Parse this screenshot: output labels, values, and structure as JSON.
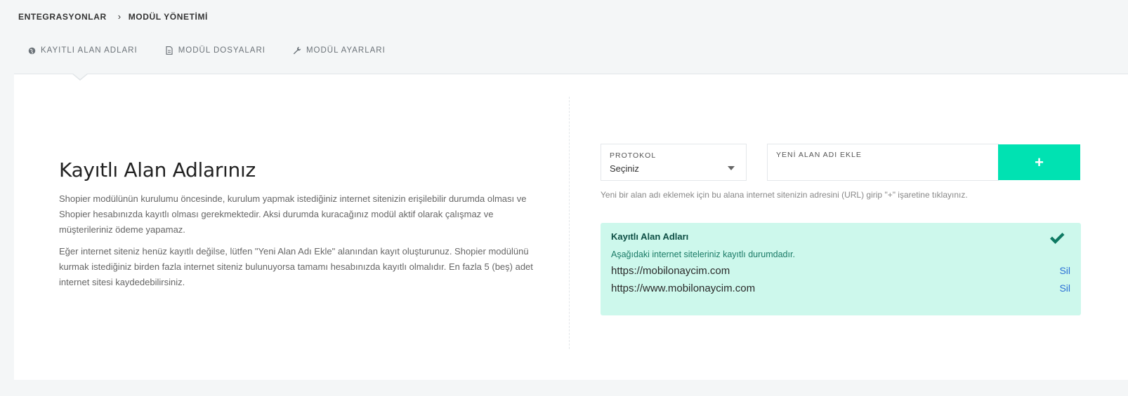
{
  "breadcrumb": {
    "root": "ENTEGRASYONLAR",
    "separator": "›",
    "current": "MODÜL YÖNETİMİ"
  },
  "tabs": [
    {
      "label": "KAYITLI ALAN ADLARI",
      "icon": "globe-icon",
      "active": true
    },
    {
      "label": "MODÜL DOSYALARI",
      "icon": "file-icon",
      "active": false
    },
    {
      "label": "MODÜL AYARLARI",
      "icon": "wrench-icon",
      "active": false
    }
  ],
  "left": {
    "title": "Kayıtlı Alan Adlarınız",
    "paragraph1": "Shopier modülünün kurulumu öncesinde, kurulum yapmak istediğiniz internet sitenizin erişilebilir durumda olması ve Shopier hesabınızda kayıtlı olması gerekmektedir. Aksi durumda kuracağınız modül aktif olarak çalışmaz ve müşterileriniz ödeme yapamaz.",
    "paragraph2": "Eğer internet siteniz henüz kayıtlı değilse, lütfen \"Yeni Alan Adı Ekle\" alanından kayıt oluşturunuz. Shopier modülünü kurmak istediğiniz birden fazla internet siteniz bulunuyorsa tamamı hesabınızda kayıtlı olmalıdır. En fazla 5 (beş) adet internet sitesi kaydedebilirsiniz."
  },
  "form": {
    "protocol_label": "PROTOKOL",
    "protocol_value": "Seçiniz",
    "domain_label": "YENİ ALAN ADI EKLE",
    "domain_value": "",
    "add_button": "+",
    "hint": "Yeni bir alan adı eklemek için bu alana internet sitenizin adresini (URL) girip \"+\" işaretine tıklayınız."
  },
  "registered": {
    "title": "Kayıtlı Alan Adları",
    "description": "Aşağıdaki internet siteleriniz kayıtlı durumdadır.",
    "domains": [
      {
        "url": "https://mobilonaycim.com",
        "action": "Sil"
      },
      {
        "url": "https://www.mobilonaycim.com",
        "action": "Sil"
      }
    ]
  },
  "colors": {
    "accent": "#00e2b2",
    "success_bg": "#cdf8ec",
    "success_check": "#0e7a63",
    "link": "#2a6fd6"
  }
}
